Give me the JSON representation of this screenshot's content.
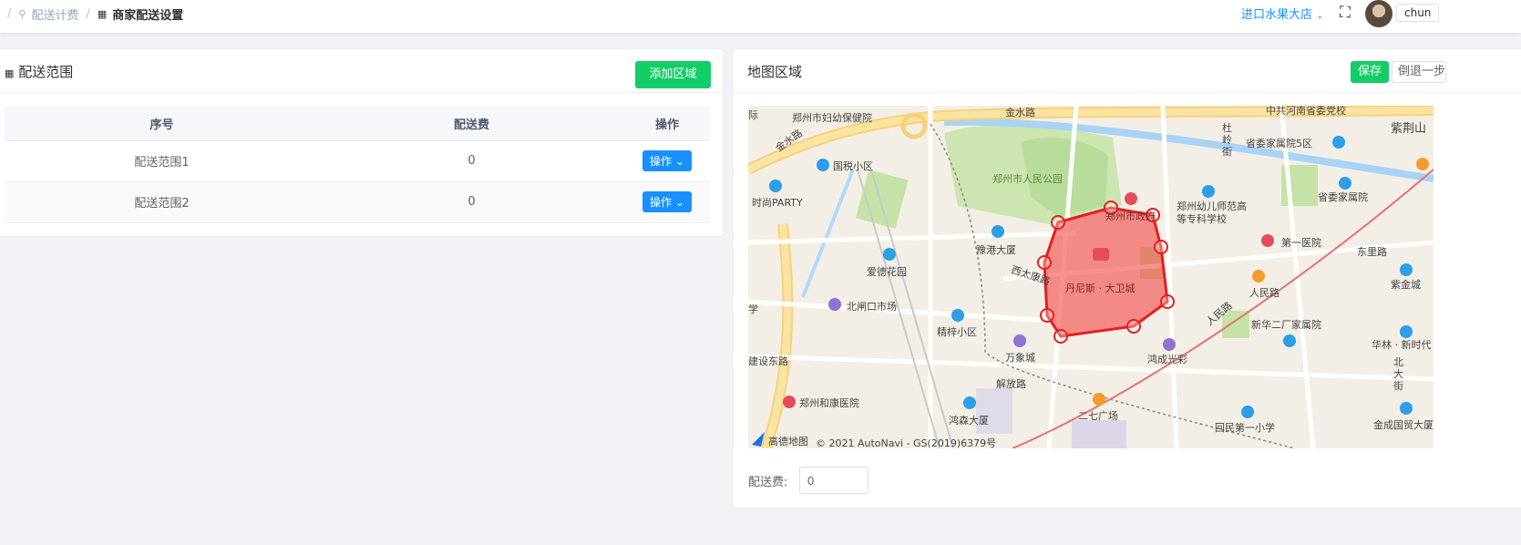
{
  "breadcrumb": {
    "separator": "/",
    "parent": "配送计费",
    "current": "商家配送设置"
  },
  "header": {
    "store_name": "进口水果大店",
    "username": "chun"
  },
  "left_panel": {
    "title": "配送范围",
    "add_button": "添加区域",
    "columns": [
      "序号",
      "配送费",
      "操作"
    ],
    "rows": [
      {
        "name": "配送范围1",
        "fee": "0",
        "action": "操作"
      },
      {
        "name": "配送范围2",
        "fee": "0",
        "action": "操作"
      }
    ]
  },
  "right_panel": {
    "title": "地图区域",
    "save_button": "保存",
    "undo_button": "倒退一步",
    "fee_label": "配送费:",
    "fee_value": "0"
  },
  "map": {
    "labels": {
      "jinshui": "金水路",
      "jinshui2": "金水路",
      "fuyou": "郑州市妇幼保健院",
      "guoshui": "国税小区",
      "park": "郑州市人民公园",
      "shishang": "时尚PARTY",
      "yugang": "豫港大厦",
      "aide": "爱德花园",
      "beizha": "北闸口市场",
      "jingzhi": "精梓小区",
      "wanxiang": "万象城",
      "jianshe": "建设东路",
      "jiefang": "解放路",
      "xitai": "西太康路",
      "dennis": "丹尼斯 · 大卫城",
      "zhengzhou_city": "郑州市政府",
      "youer": "郑州幼儿师范高等专科学校",
      "shengwei5": "省委家属院5区",
      "shengwei": "省委家属院",
      "diyi": "第一医院",
      "renmin_rd": "人民路",
      "renmin_rd2": "人民路",
      "dongli": "东里路",
      "xinhua": "新华二厂家属院",
      "hongcheng": "鸿成光彩",
      "erqi": "二七广场",
      "huimin": "回民第一小学",
      "hekang": "郑州和康医院",
      "hongsen": "鸿森大厦",
      "zijin": "紫金城",
      "hualin": "华林 · 新时代",
      "jincheng": "金成国贸大厦",
      "beidajie": "北大街",
      "zhonggong": "中共河南省委党校",
      "zijingshan": "紫荆山",
      "duling": "杜岭街",
      "xue": "学",
      "ji": "际",
      "brand": "高德地图",
      "copyright": "© 2021 AutoNavi - GS(2019)6379号"
    }
  }
}
